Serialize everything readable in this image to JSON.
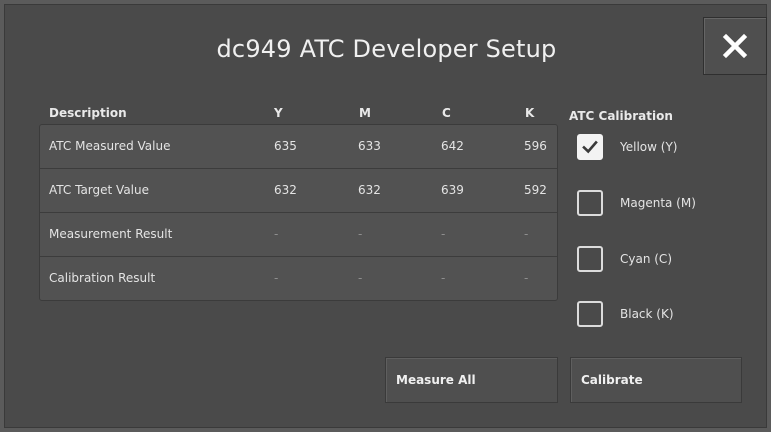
{
  "dialog": {
    "title": "dc949 ATC Developer Setup",
    "close_icon": "close-icon"
  },
  "table": {
    "headers": [
      "Description",
      "Y",
      "M",
      "C",
      "K"
    ],
    "rows": [
      {
        "label": "ATC Measured Value",
        "values": [
          "635",
          "633",
          "642",
          "596"
        ]
      },
      {
        "label": "ATC Target Value",
        "values": [
          "632",
          "632",
          "639",
          "592"
        ]
      },
      {
        "label": "Measurement Result",
        "values": [
          "-",
          "-",
          "-",
          "-"
        ]
      },
      {
        "label": "Calibration Result",
        "values": [
          "-",
          "-",
          "-",
          "-"
        ]
      }
    ]
  },
  "calibration": {
    "title": "ATC Calibration",
    "options": [
      {
        "label": "Yellow (Y)",
        "checked": true
      },
      {
        "label": "Magenta (M)",
        "checked": false
      },
      {
        "label": "Cyan (C)",
        "checked": false
      },
      {
        "label": "Black (K)",
        "checked": false
      }
    ]
  },
  "buttons": {
    "measure_all": "Measure All",
    "calibrate": "Calibrate"
  },
  "colors": {
    "background": "#4a4a4a",
    "text": "#e4e4e4",
    "dim_text": "#8e8e8e"
  }
}
